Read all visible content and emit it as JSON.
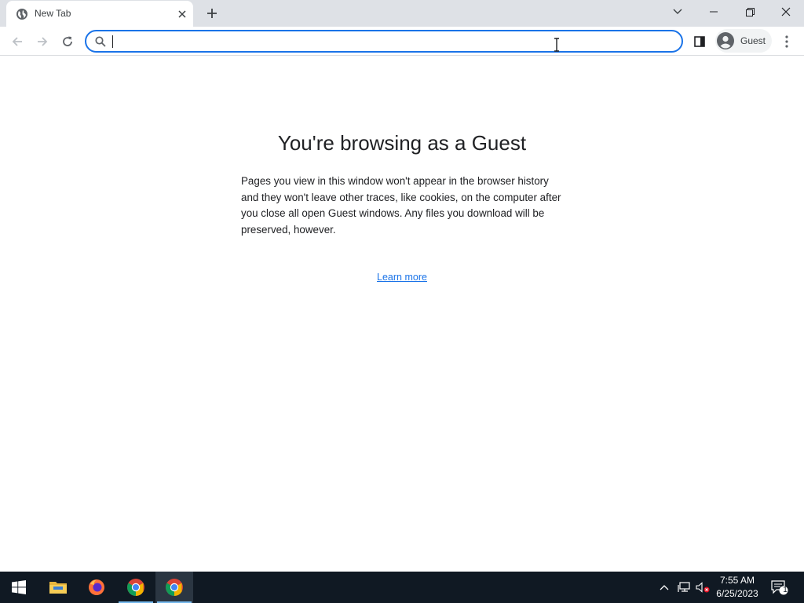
{
  "browser": {
    "tab": {
      "title": "New Tab",
      "favicon": "globe-icon"
    },
    "omnibox": {
      "value": "",
      "placeholder": ""
    },
    "profile": {
      "label": "Guest",
      "icon": "avatar-icon"
    }
  },
  "page": {
    "title": "You're browsing as a Guest",
    "description": "Pages you view in this window won't appear in the browser history and they won't leave other traces, like cookies, on the computer after you close all open Guest windows. Any files you download will be preserved, however.",
    "learn_more": "Learn more"
  },
  "taskbar": {
    "apps": [
      "start-icon",
      "file-explorer-icon",
      "firefox-icon",
      "chrome-icon",
      "chrome-icon"
    ],
    "clock": {
      "time": "7:55 AM",
      "date": "6/25/2023"
    },
    "notification_count": "1"
  },
  "colors": {
    "accent": "#1a73e8",
    "tabstrip": "#dee1e6",
    "taskbar": "#101923"
  }
}
